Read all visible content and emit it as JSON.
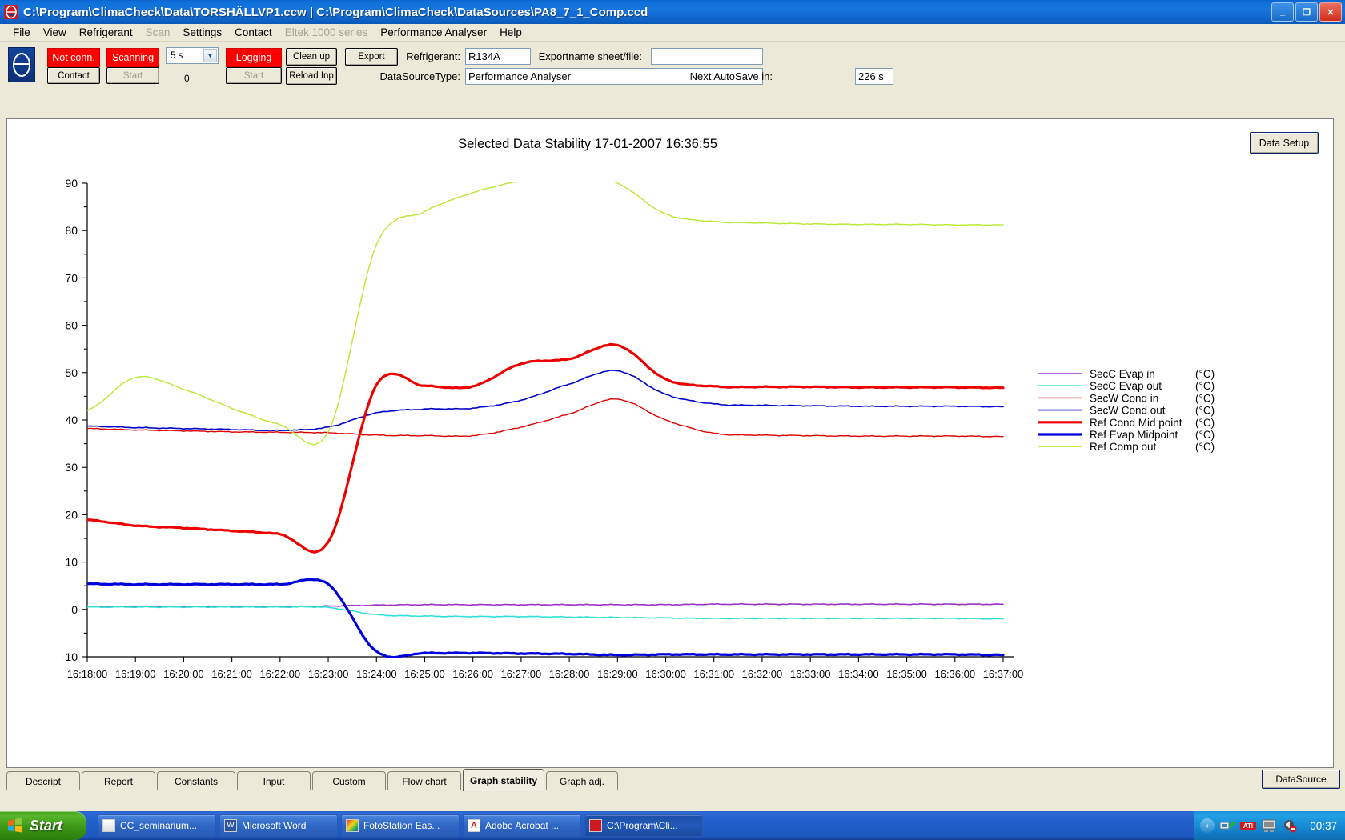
{
  "window": {
    "title": "C:\\Program\\ClimaCheck\\Data\\TORSHÄLLVP1.ccw  |  C:\\Program\\ClimaCheck\\DataSources\\PA8_7_1_Comp.ccd",
    "icon": "climacheck-app-icon",
    "minimize_label": "_",
    "maximize_label": "❐",
    "close_label": "✕"
  },
  "menu": {
    "items": [
      {
        "label": "File",
        "disabled": false
      },
      {
        "label": "View",
        "disabled": false
      },
      {
        "label": "Refrigerant",
        "disabled": false
      },
      {
        "label": "Scan",
        "disabled": true
      },
      {
        "label": "Settings",
        "disabled": false
      },
      {
        "label": "Contact",
        "disabled": false
      },
      {
        "label": "Eltek 1000 series",
        "disabled": true
      },
      {
        "label": "Performance Analyser",
        "disabled": false
      },
      {
        "label": "Help",
        "disabled": false
      }
    ]
  },
  "toolbar": {
    "conn_status": "Not conn.",
    "contact_button": "Contact",
    "scan_status": "Scanning",
    "scan_start_button": "Start",
    "interval_value": "5 s",
    "counter_value": "0",
    "log_status": "Logging",
    "log_start_button": "Start",
    "cleanup_button": "Clean up",
    "reload_button": "Reload Inp",
    "export_button": "Export",
    "refrigerant_label": "Refrigerant:",
    "refrigerant_value": "R134A",
    "exportname_label": "Exportname sheet/file:",
    "exportname_value": "",
    "exportname_placeholder": "",
    "datasourcetype_label": "DataSourceType:",
    "datasourcetype_value": "Performance Analyser",
    "autosave_label": "Next AutoSave in:",
    "autosave_value": "226 s"
  },
  "chart_panel": {
    "data_setup_button": "Data Setup"
  },
  "chart_data": {
    "type": "line",
    "title": "Selected Data Stability  17-01-2007 16:36:55",
    "xlabel": "",
    "ylabel": "",
    "ylim": [
      -10,
      90
    ],
    "ytick_step": 10,
    "yminor_step": 5,
    "grid": false,
    "legend_position": "right",
    "yticks": [
      -10,
      0,
      10,
      20,
      30,
      40,
      50,
      60,
      70,
      80,
      90
    ],
    "xticks": [
      "16:18:00",
      "16:19:00",
      "16:20:00",
      "16:21:00",
      "16:22:00",
      "16:23:00",
      "16:24:00",
      "16:25:00",
      "16:26:00",
      "16:27:00",
      "16:28:00",
      "16:29:00",
      "16:30:00",
      "16:31:00",
      "16:32:00",
      "16:33:00",
      "16:34:00",
      "16:35:00",
      "16:36:00",
      "16:37:00"
    ],
    "xlim": [
      "16:17:30",
      "16:37:20"
    ],
    "units": "(°C)",
    "series": [
      {
        "name": "SecC Evap in",
        "unit": "(°C)",
        "color": "#9933cc",
        "width": 1.6,
        "x": [
          0,
          1,
          2,
          3,
          4,
          5,
          6,
          7,
          8,
          9,
          10,
          11,
          12,
          13,
          14,
          15,
          16,
          17,
          18,
          19
        ],
        "values": [
          0.6,
          0.6,
          0.6,
          0.6,
          0.6,
          0.7,
          0.9,
          1.0,
          1.0,
          1.0,
          1.0,
          1.0,
          1.0,
          1.1,
          1.1,
          1.1,
          1.1,
          1.1,
          1.1,
          1.1
        ]
      },
      {
        "name": "SecC Evap out",
        "unit": "(°C)",
        "color": "#30e0d8",
        "width": 1.6,
        "x": [
          0,
          1,
          2,
          3,
          4,
          5,
          6,
          7,
          8,
          9,
          10,
          11,
          12,
          13,
          14,
          15,
          16,
          17,
          18,
          19
        ],
        "values": [
          0.5,
          0.5,
          0.5,
          0.5,
          0.5,
          0.4,
          -1.1,
          -1.4,
          -1.5,
          -1.5,
          -1.6,
          -1.7,
          -1.8,
          -1.9,
          -1.9,
          -1.9,
          -1.9,
          -1.9,
          -1.9,
          -2.0
        ]
      },
      {
        "name": "SecW Cond in",
        "unit": "(°C)",
        "color": "#e00000",
        "width": 1.4,
        "x": [
          0,
          1,
          2,
          3,
          4,
          5,
          6,
          7,
          8,
          9,
          10,
          11,
          12,
          13,
          14,
          15,
          16,
          17,
          18,
          19
        ],
        "values": [
          38.2,
          37.9,
          37.7,
          37.5,
          37.4,
          37.3,
          36.8,
          36.7,
          36.7,
          38.5,
          41.3,
          44.4,
          40.0,
          37.2,
          36.8,
          36.7,
          36.6,
          36.6,
          36.6,
          36.5
        ]
      },
      {
        "name": "SecW  Cond out",
        "unit": "(°C)",
        "color": "#0000cc",
        "width": 1.6,
        "x": [
          0,
          1,
          2,
          3,
          4,
          5,
          6,
          7,
          8,
          9,
          10,
          11,
          12,
          13,
          14,
          15,
          16,
          17,
          18,
          19
        ],
        "values": [
          38.7,
          38.4,
          38.2,
          38.0,
          37.8,
          38.5,
          41.5,
          42.3,
          42.5,
          44.2,
          47.6,
          50.4,
          45.4,
          43.4,
          43.1,
          43.0,
          42.9,
          42.9,
          42.9,
          42.8
        ]
      },
      {
        "name": "Ref Cond Mid point",
        "unit": "(°C)",
        "color": "#ee0000",
        "width": 3.2,
        "x": [
          0,
          1,
          2,
          3,
          4,
          5,
          6,
          7,
          8,
          9,
          10,
          11,
          12,
          13,
          14,
          15,
          16,
          17,
          18,
          19
        ],
        "values": [
          18.9,
          17.7,
          17.2,
          16.6,
          15.9,
          14.2,
          47.4,
          47.2,
          47.1,
          51.9,
          52.9,
          55.8,
          48.6,
          47.1,
          47.0,
          47.0,
          46.9,
          46.9,
          46.9,
          46.8
        ]
      },
      {
        "name": "Ref Evap Midpoint",
        "unit": "(°C)",
        "color": "#0000dd",
        "width": 3.2,
        "x": [
          0,
          1,
          2,
          3,
          4,
          5,
          6,
          7,
          8,
          9,
          10,
          11,
          12,
          13,
          14,
          15,
          16,
          17,
          18,
          19
        ],
        "values": [
          5.4,
          5.3,
          5.3,
          5.3,
          5.3,
          5.3,
          -8.9,
          -9.2,
          -9.2,
          -9.3,
          -9.4,
          -9.6,
          -9.5,
          -9.5,
          -9.5,
          -9.5,
          -9.5,
          -9.5,
          -9.5,
          -9.6
        ]
      },
      {
        "name": "Ref Comp out",
        "unit": "(°C)",
        "color": "#bbe830",
        "width": 1.4,
        "x": [
          0,
          1,
          2,
          3,
          4,
          5,
          6,
          7,
          8,
          9,
          10,
          11,
          12,
          13,
          14,
          15,
          16,
          17,
          18,
          19
        ],
        "values": [
          42.0,
          49.0,
          46.5,
          42.5,
          39.0,
          37.5,
          77.0,
          84.0,
          88.0,
          90.5,
          92.0,
          90.0,
          83.5,
          81.9,
          81.6,
          81.4,
          81.3,
          81.3,
          81.2,
          81.2
        ]
      }
    ]
  },
  "tabs": {
    "items": [
      {
        "label": "Descript",
        "active": false
      },
      {
        "label": "Report",
        "active": false
      },
      {
        "label": "Constants",
        "active": false
      },
      {
        "label": "Input",
        "active": false
      },
      {
        "label": "Custom",
        "active": false
      },
      {
        "label": "Flow chart",
        "active": false
      },
      {
        "label": "Graph stability",
        "active": true
      },
      {
        "label": "Graph adj.",
        "active": false
      }
    ],
    "datasource_button": "DataSource"
  },
  "taskbar": {
    "start_label": "Start",
    "items": [
      {
        "label": "CC_seminarium...",
        "icon": "document-icon",
        "active": false
      },
      {
        "label": "Microsoft Word",
        "icon": "word-icon",
        "active": false
      },
      {
        "label": "FotoStation Eas...",
        "icon": "fotostation-icon",
        "active": false
      },
      {
        "label": "Adobe Acrobat ...",
        "icon": "acrobat-icon",
        "active": false
      },
      {
        "label": "C:\\Program\\Cli...",
        "icon": "climacheck-icon",
        "active": true
      }
    ],
    "tray": {
      "show_hidden_label": "‹",
      "icons": [
        "network-icon",
        "ati-icon",
        "display-icon",
        "volume-muted-icon"
      ],
      "clock": "00:37"
    }
  }
}
